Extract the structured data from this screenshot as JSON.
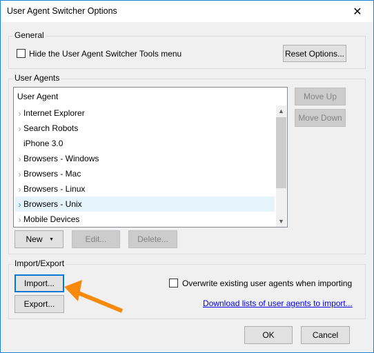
{
  "window": {
    "title": "User Agent Switcher Options",
    "close_icon": "close-icon"
  },
  "general": {
    "label": "General",
    "hide_menu_label": "Hide the User Agent Switcher Tools menu",
    "hide_menu_checked": false,
    "reset_button": "Reset Options..."
  },
  "user_agents": {
    "label": "User Agents",
    "column_header": "User Agent",
    "items": [
      {
        "label": "Internet Explorer",
        "expandable": true,
        "selected": false
      },
      {
        "label": "Search Robots",
        "expandable": true,
        "selected": false
      },
      {
        "label": "iPhone 3.0",
        "expandable": false,
        "selected": false
      },
      {
        "label": "Browsers - Windows",
        "expandable": true,
        "selected": false
      },
      {
        "label": "Browsers - Mac",
        "expandable": true,
        "selected": false
      },
      {
        "label": "Browsers - Linux",
        "expandable": true,
        "selected": false
      },
      {
        "label": "Browsers - Unix",
        "expandable": true,
        "selected": true
      },
      {
        "label": "Mobile Devices",
        "expandable": true,
        "selected": false
      }
    ],
    "move_up": "Move Up",
    "move_down": "Move Down",
    "new_button": "New",
    "edit_button": "Edit...",
    "delete_button": "Delete..."
  },
  "import_export": {
    "label": "Import/Export",
    "import_button": "Import...",
    "export_button": "Export...",
    "overwrite_label": "Overwrite existing user agents when importing",
    "overwrite_checked": false,
    "download_link": "Download lists of user agents to import..."
  },
  "footer": {
    "ok": "OK",
    "cancel": "Cancel"
  },
  "colors": {
    "accent": "#0078d7",
    "annotation_arrow": "#f7890d",
    "selection": "#e5f3fb"
  }
}
